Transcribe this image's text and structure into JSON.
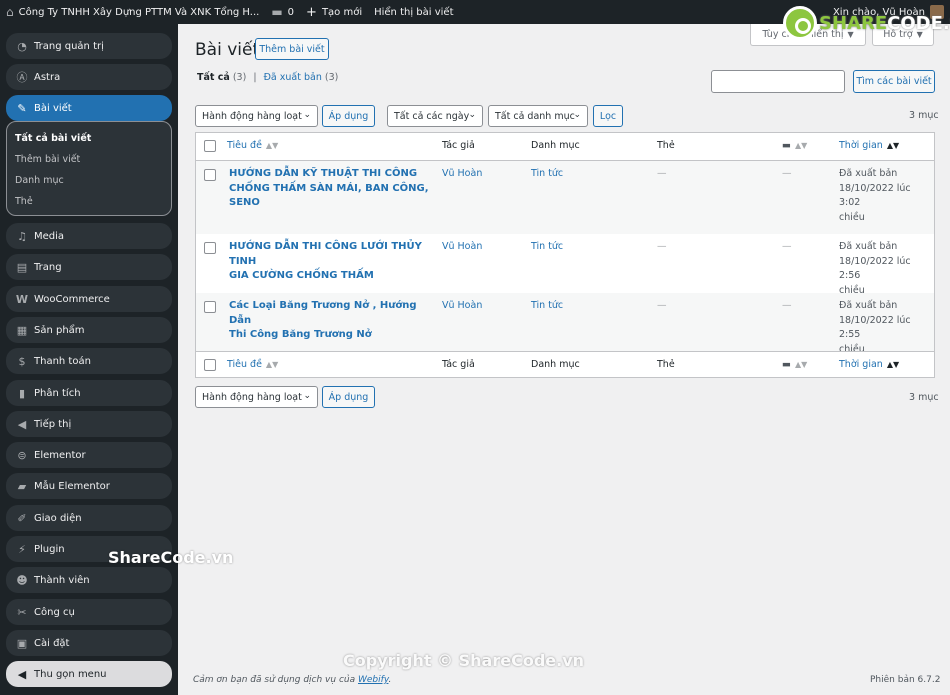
{
  "admin_bar": {
    "site_name": "Công Ty TNHH Xây Dựng PTTM Và XNK Tổng H...",
    "comments_count": "0",
    "new_label": "Tạo mới",
    "view_posts_label": "Hiển thị bài viết",
    "greeting": "Xin chào, Vũ Hoàn"
  },
  "sidebar": {
    "items": [
      {
        "label": "Trang quản trị",
        "icon": "dashboard-icon"
      },
      {
        "label": "Astra",
        "icon": "astra-icon"
      },
      {
        "label": "Bài viết",
        "icon": "pin-icon",
        "active": true
      },
      {
        "label": "Media",
        "icon": "media-icon"
      },
      {
        "label": "Trang",
        "icon": "page-icon"
      },
      {
        "label": "WooCommerce",
        "icon": "woocommerce-icon"
      },
      {
        "label": "Sản phẩm",
        "icon": "products-icon"
      },
      {
        "label": "Thanh toán",
        "icon": "payments-icon"
      },
      {
        "label": "Phân tích",
        "icon": "analytics-icon"
      },
      {
        "label": "Tiếp thị",
        "icon": "megaphone-icon"
      },
      {
        "label": "Elementor",
        "icon": "elementor-icon"
      },
      {
        "label": "Mẫu Elementor",
        "icon": "folder-icon"
      },
      {
        "label": "Giao diện",
        "icon": "brush-icon"
      },
      {
        "label": "Plugin",
        "icon": "plugin-icon"
      },
      {
        "label": "Thành viên",
        "icon": "users-icon"
      },
      {
        "label": "Công cụ",
        "icon": "wrench-icon"
      },
      {
        "label": "Cài đặt",
        "icon": "settings-icon"
      }
    ],
    "submenu": [
      "Tất cả bài viết",
      "Thêm bài viết",
      "Danh mục",
      "Thẻ"
    ],
    "collapse_label": "Thu gọn menu"
  },
  "header": {
    "screen_options": "Tùy chọn hiển thị",
    "help": "Hỗ trợ",
    "title": "Bài viết",
    "add_new": "Thêm bài viết"
  },
  "views": {
    "all_label": "Tất cả",
    "all_count": "(3)",
    "separator": "|",
    "published_label": "Đã xuất bản",
    "published_count": "(3)"
  },
  "search": {
    "value": "",
    "button": "Tìm các bài viết"
  },
  "filters": {
    "bulk_action": "Hành động hàng loạt",
    "apply": "Áp dụng",
    "dates": "Tất cả các ngày",
    "categories": "Tất cả danh mục",
    "filter": "Lọc"
  },
  "items_count": "3 mục",
  "table": {
    "columns": {
      "title": "Tiêu đề",
      "author": "Tác giả",
      "categories": "Danh mục",
      "tags": "Thẻ",
      "date": "Thời gian"
    },
    "rows": [
      {
        "title_line1": "HƯỚNG DẪN KỸ THUẬT THI CÔNG",
        "title_line2": "CHỐNG THẤM SÀN MÁI, BAN CÔNG,",
        "title_line3": "SENO",
        "author": "Vũ Hoàn",
        "category": "Tin tức",
        "tags": "—",
        "comments": "—",
        "status": "Đã xuất bản",
        "date": "18/10/2022 lúc 3:02",
        "date_suffix": "chiều"
      },
      {
        "title_line1": "HƯỚNG DẪN THI CÔNG LƯỚI THỦY TINH",
        "title_line2": "GIA CƯỜNG CHỐNG THẤM",
        "title_line3": "",
        "author": "Vũ Hoàn",
        "category": "Tin tức",
        "tags": "—",
        "comments": "—",
        "status": "Đã xuất bản",
        "date": "18/10/2022 lúc 2:56",
        "date_suffix": "chiều"
      },
      {
        "title_line1": "Các Loại Băng Trương Nở , Hướng Dẫn",
        "title_line2": "Thi Công Băng Trương Nở",
        "title_line3": "",
        "author": "Vũ Hoàn",
        "category": "Tin tức",
        "tags": "—",
        "comments": "—",
        "status": "Đã xuất bản",
        "date": "18/10/2022 lúc 2:55",
        "date_suffix": "chiều"
      }
    ]
  },
  "footer": {
    "thanks_prefix": "Cảm ơn bạn đã sử dụng dịch vụ của",
    "thanks_link": "Webify",
    "thanks_suffix": ".",
    "version": "Phiên bản 6.7.2"
  },
  "watermarks": {
    "logo_prefix": "SHARE",
    "logo_suffix": "CODE.vn",
    "sidebar": "ShareCode.vn",
    "bottom": "Copyright © ShareCode.vn"
  },
  "colors": {
    "accent": "#2271b1",
    "sidebar_bg": "#1d2327",
    "page_bg": "#f0f0f1"
  }
}
